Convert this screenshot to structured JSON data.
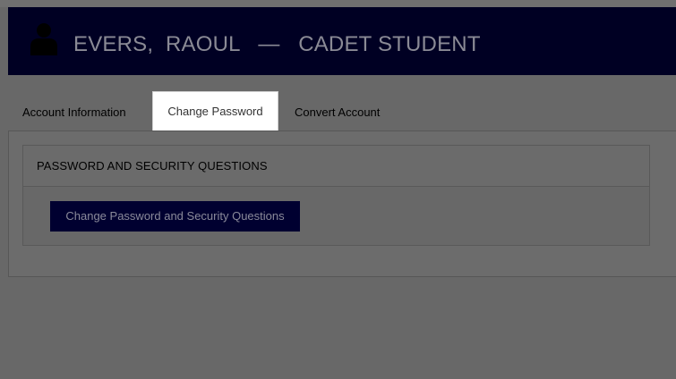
{
  "header": {
    "name": "EVERS,  RAOUL",
    "separator": "—",
    "role": "CADET STUDENT",
    "avatar_icon": "user-silhouette-icon"
  },
  "tabs": [
    {
      "label": "Account Information",
      "active": false
    },
    {
      "label": "Change Password",
      "active": true
    },
    {
      "label": "Convert Account",
      "active": false
    }
  ],
  "panel": {
    "title": "PASSWORD AND SECURITY QUESTIONS",
    "button_label": "Change Password and Security Questions"
  },
  "colors": {
    "header_bg": "#000023",
    "button_bg": "#000030",
    "overlay_bg": "#686868",
    "active_tab_bg": "#ffffff"
  }
}
